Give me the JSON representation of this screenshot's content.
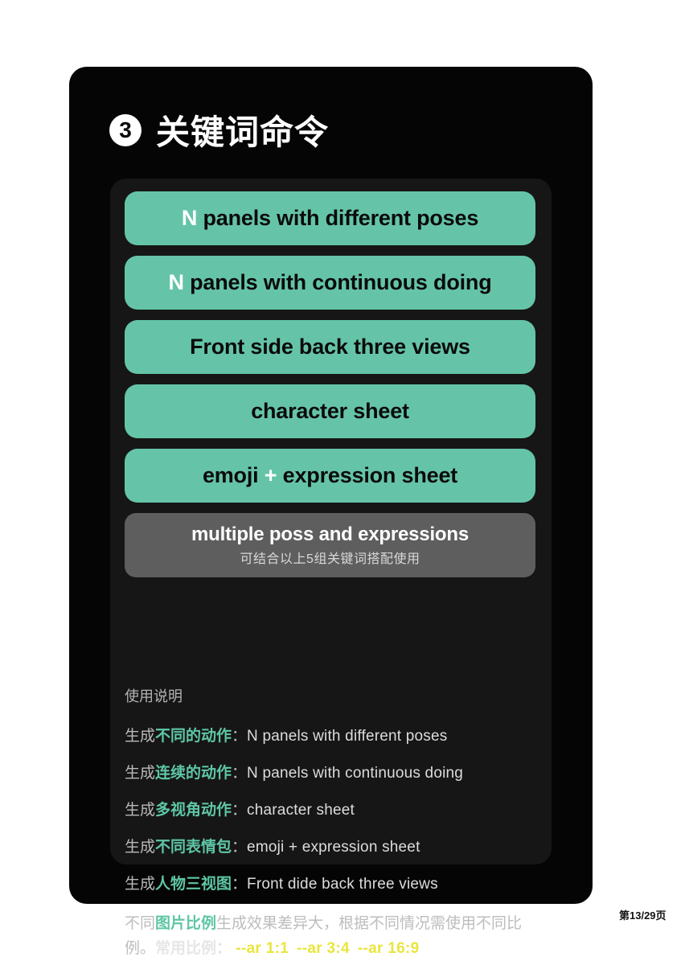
{
  "page": {
    "background": "#ffffff",
    "card_background": "#050505",
    "panel_background": "#161616",
    "accent_green": "#65c4a8",
    "accent_yellow": "#e9e63c",
    "gray_pill": "#5e5e5e"
  },
  "header": {
    "badge": "3",
    "title": "关键词命令"
  },
  "pills": [
    {
      "prefix": "N",
      "prefix_color": "#ffffff",
      "text": " panels with different poses",
      "style": "green"
    },
    {
      "prefix": "N",
      "prefix_color": "#ffffff",
      "text": " panels with continuous doing",
      "style": "green"
    },
    {
      "prefix": "",
      "prefix_color": "",
      "text": "Front side back three views",
      "style": "green"
    },
    {
      "prefix": "",
      "prefix_color": "",
      "text": "character sheet",
      "style": "green"
    },
    {
      "prefix": "",
      "prefix_color": "",
      "text": "emoji + expression sheet",
      "style": "green",
      "plus_white": true
    }
  ],
  "gray_pill": {
    "main": "multiple poss and expressions",
    "sub": "可结合以上5组关键词搭配使用"
  },
  "notes": {
    "title": "使用说明",
    "rows": [
      {
        "plain": "生成",
        "highlight": "不同的动作",
        "colon": "：",
        "value": "N panels with different poses"
      },
      {
        "plain": "生成",
        "highlight": "连续的动作",
        "colon": "：",
        "value": "N panels with continuous doing"
      },
      {
        "plain": "生成",
        "highlight": "多视角动作",
        "colon": "：",
        "value": "character sheet"
      },
      {
        "plain": "生成",
        "highlight": "不同表情包",
        "colon": "：",
        "value": "emoji + expression sheet"
      },
      {
        "plain": "生成",
        "highlight": "人物三视图",
        "colon": "：",
        "value": "Front dide back three views"
      }
    ],
    "paragraph": {
      "part1": "不同",
      "highlight1": "图片比例",
      "part2": "生成效果差异大，根据不同情况需使用不同比例。",
      "strong": "常用比例：",
      "ratios": [
        "--ar 1:1",
        "--ar 3:4",
        "--ar 16:9"
      ]
    }
  },
  "footer": {
    "page_label": "第13/29页"
  }
}
